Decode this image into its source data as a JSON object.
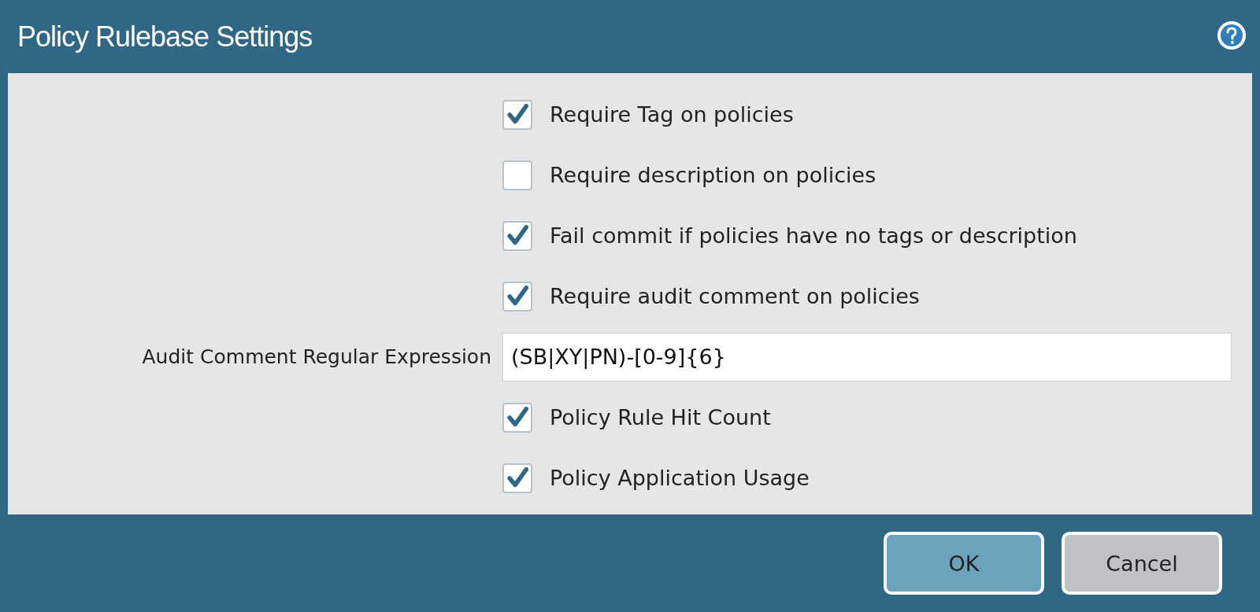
{
  "window": {
    "title": "Policy Rulebase Settings"
  },
  "settings": [
    {
      "kind": "checkbox",
      "label": "Require Tag on policies",
      "checked": true
    },
    {
      "kind": "checkbox",
      "label": "Require description on policies",
      "checked": false
    },
    {
      "kind": "checkbox",
      "label": "Fail commit if policies have no tags or description",
      "checked": true
    },
    {
      "kind": "checkbox",
      "label": "Require audit comment on policies",
      "checked": true
    },
    {
      "kind": "text-field",
      "label": "Audit Comment Regular Expression",
      "value": "(SB|XY|PN)-[0-9]{6}"
    },
    {
      "kind": "checkbox",
      "label": "Policy Rule Hit Count",
      "checked": true
    },
    {
      "kind": "checkbox",
      "label": "Policy Application Usage",
      "checked": true
    }
  ],
  "buttons": [
    {
      "label": "OK",
      "kind": "primary"
    },
    {
      "label": "Cancel",
      "kind": "secondary"
    }
  ]
}
